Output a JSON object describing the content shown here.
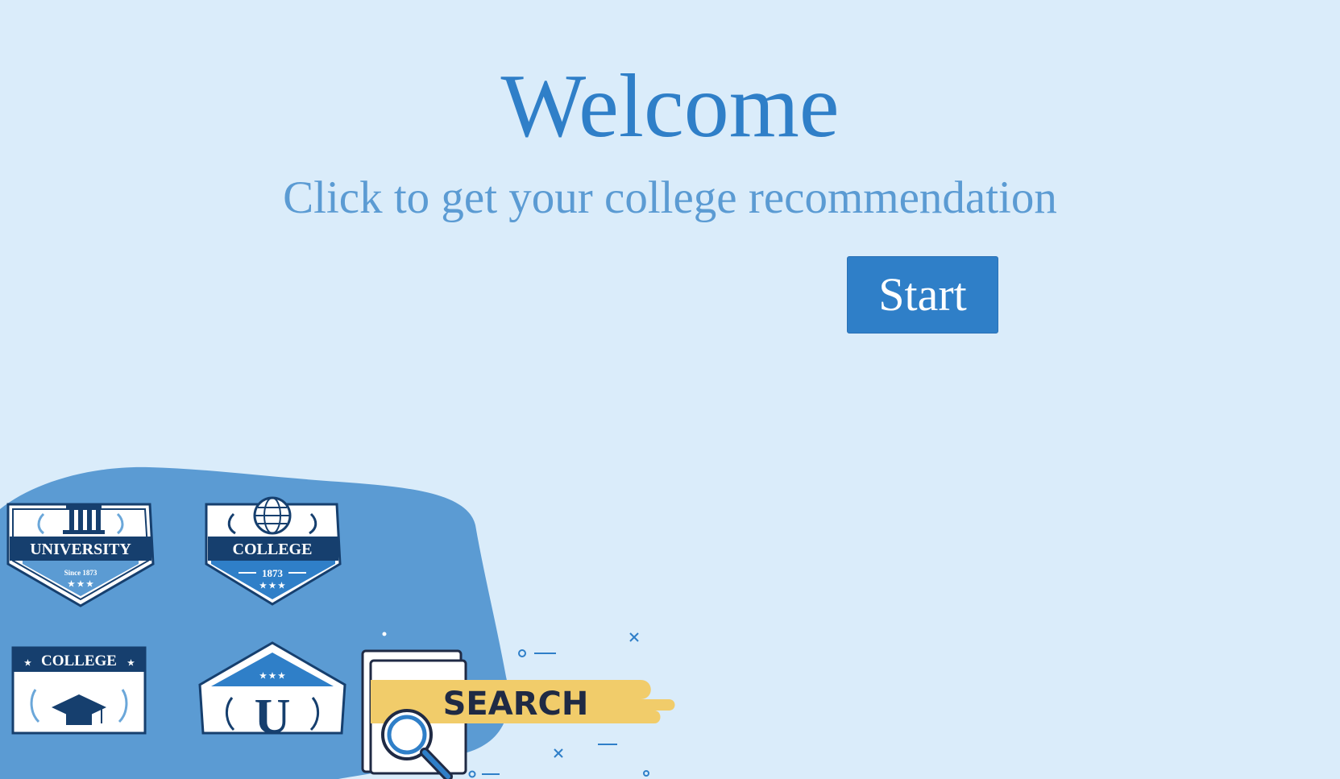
{
  "hero": {
    "title": "Welcome",
    "subtitle": "Click to get your college recommendation",
    "start_label": "Start"
  },
  "illustration": {
    "badges": {
      "university": {
        "label": "UNIVERSITY",
        "since": "Since 1873",
        "icon": "pillars-icon"
      },
      "college_globe": {
        "label": "COLLEGE",
        "year": "1873",
        "icon": "globe-icon"
      },
      "college_cap": {
        "label": "COLLEGE",
        "icon": "graduation-cap-icon"
      },
      "u_shield": {
        "label": "U",
        "icon": "star-icon"
      }
    },
    "search_banner": {
      "label": "SEARCH",
      "icon": "magnifier-icon"
    }
  },
  "colors": {
    "background": "#daecfa",
    "primary": "#2f7fc8",
    "subtitle": "#5b9bd3",
    "blob": "#5b9bd3",
    "badge_dark": "#163f6e",
    "search_banner": "#f1cc6a"
  }
}
